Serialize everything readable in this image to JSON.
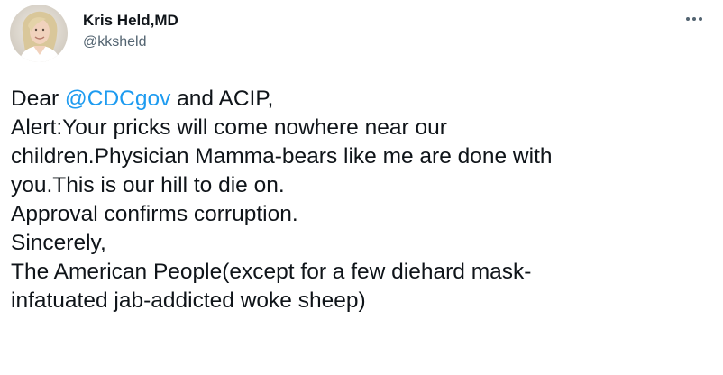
{
  "author": {
    "display_name": "Kris Held,MD",
    "handle": "@kksheld",
    "avatar_icon": "profile-photo"
  },
  "menu": {
    "more_icon": "more-horizontal-icon"
  },
  "tweet": {
    "line1": {
      "prefix": "Dear ",
      "mention": "@CDCgov",
      "suffix": " and ACIP,"
    },
    "lines": [
      "Alert:Your pricks will come nowhere near our",
      "children.Physician Mamma-bears like me are done with",
      "you.This is our hill to die on.",
      "Approval confirms corruption.",
      "Sincerely,",
      "The American People(except for a few diehard mask-",
      "infatuated jab-addicted woke sheep)"
    ]
  },
  "colors": {
    "text": "#0f1419",
    "secondary": "#536471",
    "accent": "#1d9bf0",
    "background": "#ffffff"
  }
}
